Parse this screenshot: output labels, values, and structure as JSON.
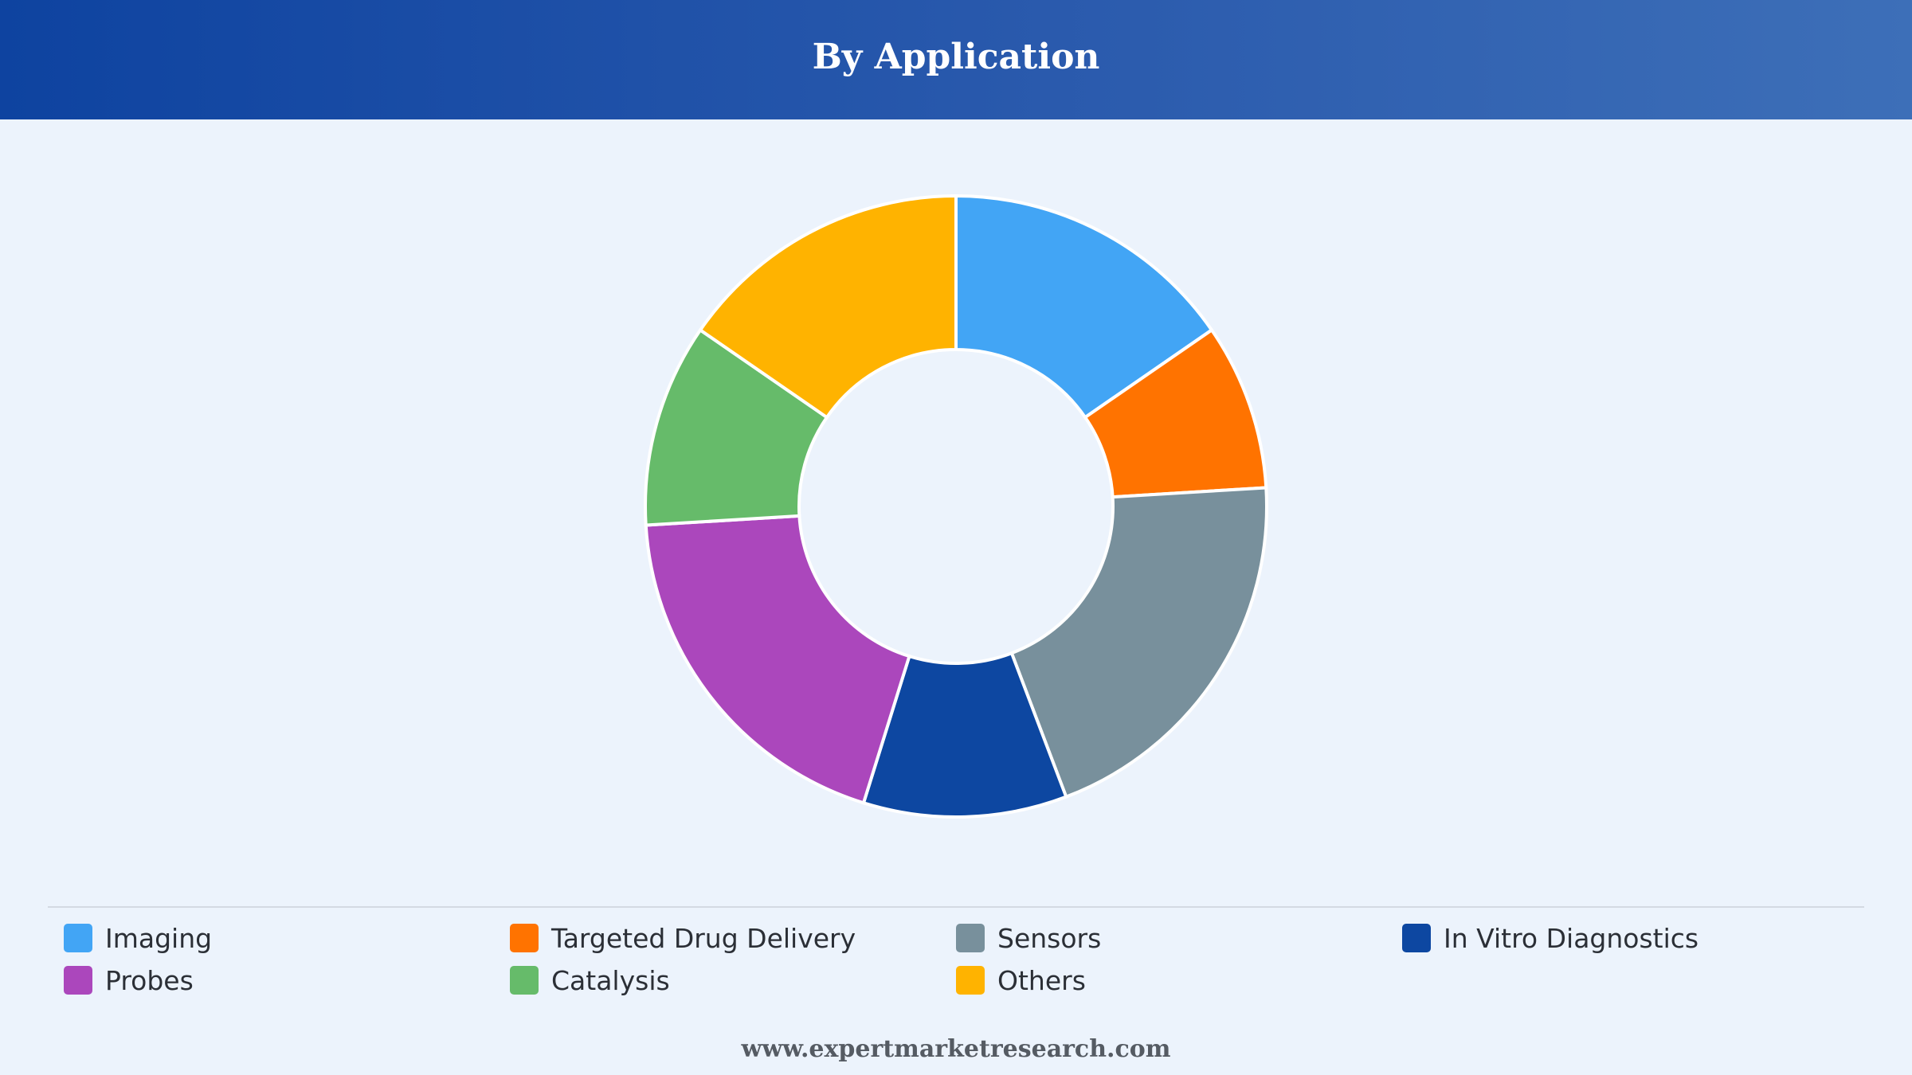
{
  "header": {
    "title": "By Application"
  },
  "chart_data": {
    "type": "pie",
    "title": "By Application",
    "donut": true,
    "legend_position": "bottom",
    "slices": [
      {
        "label": "Imaging",
        "value": 16,
        "color": "#42a5f5"
      },
      {
        "label": "Targeted Drug Delivery",
        "value": 9,
        "color": "#ff7300"
      },
      {
        "label": "Sensors",
        "value": 21,
        "color": "#78909c"
      },
      {
        "label": "In Vitro Diagnostics",
        "value": 11,
        "color": "#0d47a1"
      },
      {
        "label": "Probes",
        "value": 20,
        "color": "#ab47bc"
      },
      {
        "label": "Catalysis",
        "value": 11,
        "color": "#66bb6a"
      },
      {
        "label": "Others",
        "value": 16,
        "color": "#ffb300"
      }
    ]
  },
  "footer": {
    "website": "www.expertmarketresearch.com"
  }
}
